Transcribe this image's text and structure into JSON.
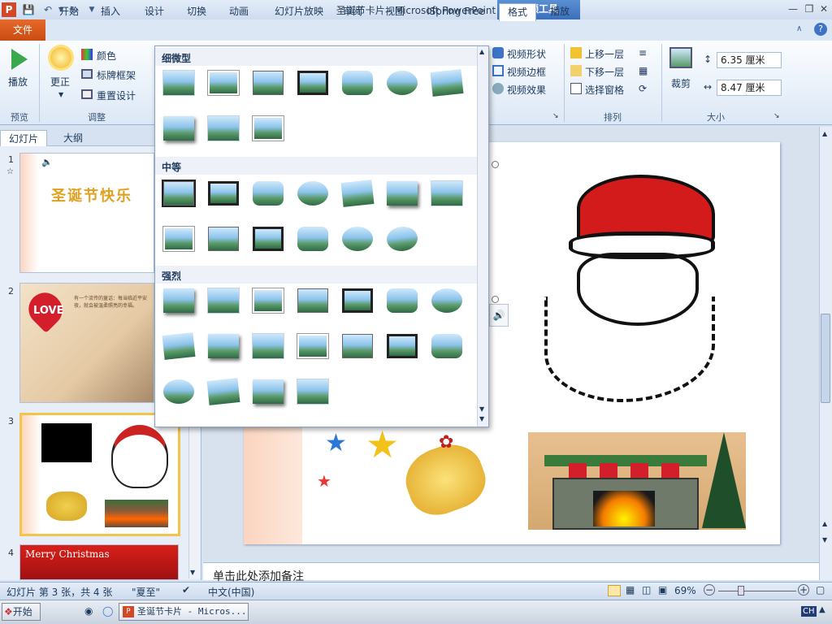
{
  "window": {
    "title": "圣诞节卡片 - Microsoft PowerPoint",
    "context_tool": "视频工具",
    "app_icon_letter": "P"
  },
  "tabs": [
    "文件",
    "开始",
    "插入",
    "设计",
    "切换",
    "动画",
    "幻灯片放映",
    "审阅",
    "视图",
    "iSpring Free",
    "格式",
    "播放"
  ],
  "ribbon": {
    "preview": {
      "play": "播放",
      "group": "预览"
    },
    "adjust": {
      "correct": "更正",
      "color": "颜色",
      "poster": "标牌框架",
      "reset": "重置设计",
      "group": "调整"
    },
    "video_style": {
      "shape": "视频形状",
      "border": "视频边框",
      "effects": "视频效果"
    },
    "arrange": {
      "forward": "上移一层",
      "backward": "下移一层",
      "pane": "选择窗格",
      "group": "排列"
    },
    "size": {
      "crop": "裁剪",
      "height": "6.35 厘米",
      "width": "8.47 厘米",
      "group": "大小"
    }
  },
  "left_panel": {
    "tab_slides": "幻灯片",
    "tab_outline": "大纲",
    "slides": [
      {
        "num": "1",
        "title": "圣诞节快乐"
      },
      {
        "num": "2",
        "love": "LOVE",
        "body": "有一个流传的童话：每当临近平安夜，就会被温柔照亮的幸福。"
      },
      {
        "num": "3"
      },
      {
        "num": "4",
        "title": "Merry Christmas"
      }
    ]
  },
  "gallery": {
    "sections": [
      "细微型",
      "中等",
      "强烈"
    ]
  },
  "notes": "单击此处添加备注",
  "status": {
    "slide": "幻灯片 第 3 张，共 4 张",
    "theme": "\"夏至\"",
    "lang": "中文(中国)",
    "zoom": "69%"
  },
  "taskbar": {
    "start": "开始",
    "window": "圣诞节卡片 - Micros...",
    "ime": "CH"
  }
}
